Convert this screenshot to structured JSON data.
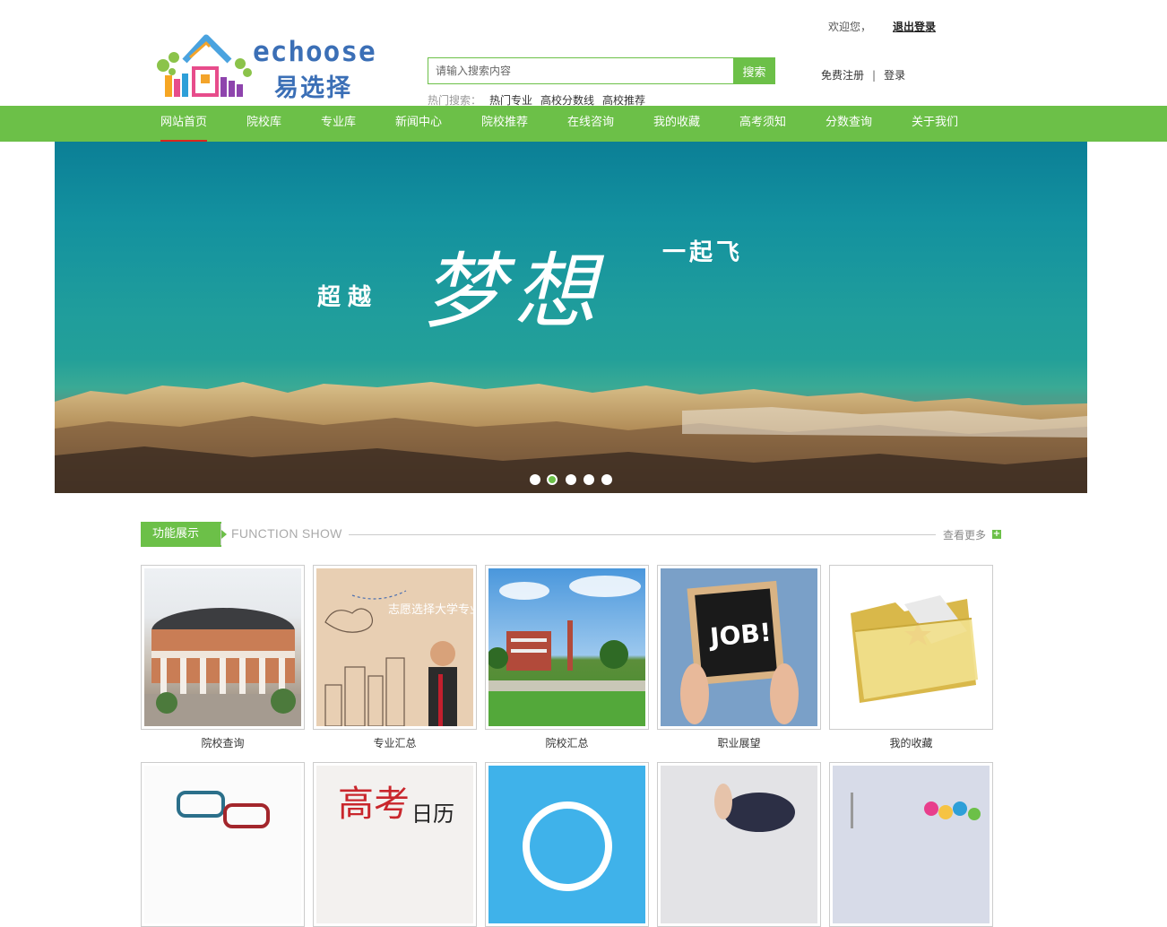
{
  "header": {
    "logo_en": "echoose",
    "logo_cn": "易选择",
    "welcome": "欢迎您，",
    "logout": "退出登录",
    "register": "免费注册",
    "separator": "|",
    "login": "登录"
  },
  "search": {
    "placeholder": "请输入搜索内容",
    "button": "搜索",
    "hot_label": "热门搜索：",
    "hot_links": [
      "热门专业",
      "高校分数线",
      "高校推荐"
    ]
  },
  "nav": {
    "items": [
      "网站首页",
      "院校库",
      "专业库",
      "新闻中心",
      "院校推荐",
      "在线咨询",
      "我的收藏",
      "高考须知",
      "分数查询",
      "关于我们"
    ],
    "active_index": 0
  },
  "banner": {
    "text_left": "超越",
    "text_main": "梦想",
    "text_right": "一起飞",
    "slide_count": 5,
    "active_slide": 1
  },
  "section": {
    "title": "功能展示",
    "title_en": "FUNCTION SHOW",
    "more": "查看更多",
    "more_icon": "plus-icon"
  },
  "cards": [
    {
      "label": "院校查询",
      "image": "campus-building-photo"
    },
    {
      "label": "专业汇总",
      "image": "sketch-boy-telescope",
      "overlay_text": "志愿选择大学专业"
    },
    {
      "label": "院校汇总",
      "image": "campus-lawn-photo"
    },
    {
      "label": "职业展望",
      "image": "job-chalkboard-photo",
      "overlay_text": "JOB!"
    },
    {
      "label": "我的收藏",
      "image": "yellow-folder-icon"
    }
  ],
  "cards_row2": [
    {
      "image": "speech-bubbles-sketch"
    },
    {
      "image": "gaokao-calendar",
      "overlay_text": "高考日历"
    },
    {
      "image": "blue-circle-icon"
    },
    {
      "image": "vr-headset-photo"
    },
    {
      "image": "colorful-chart-photo"
    }
  ],
  "colors": {
    "accent": "#6cc048",
    "nav_active_underline": "#d9261c",
    "logo_blue": "#3b6fb6"
  }
}
